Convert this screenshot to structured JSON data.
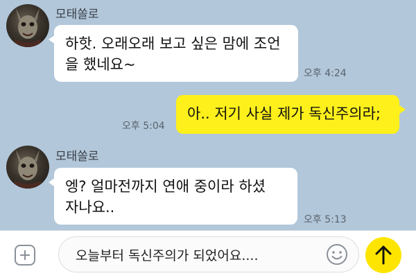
{
  "messages": [
    {
      "sender": "모태쏠로",
      "lines": [
        "하핫. 오래오래 보고 싶은 맘에 조언",
        "을 했네요~"
      ],
      "time": "오후 4:24",
      "direction": "incoming"
    },
    {
      "sender": "",
      "lines": [
        "아.. 저기 사실 제가 독신주의라;"
      ],
      "time": "오후 5:04",
      "direction": "outgoing"
    },
    {
      "sender": "모태쏠로",
      "lines": [
        "엥? 얼마전까지 연애 중이라 하셨",
        "자나요.."
      ],
      "time": "오후 5:13",
      "direction": "incoming"
    }
  ],
  "composer": {
    "text": "오늘부터 독신주의가 되었어요....",
    "plus_icon": "plus-icon",
    "emoji_icon": "emoji-icon",
    "send_icon": "send-arrow-up-icon"
  },
  "colors": {
    "background": "#b2c7d9",
    "incoming_bubble": "#ffffff",
    "outgoing_bubble": "#fef01b",
    "send_button": "#fee500"
  }
}
